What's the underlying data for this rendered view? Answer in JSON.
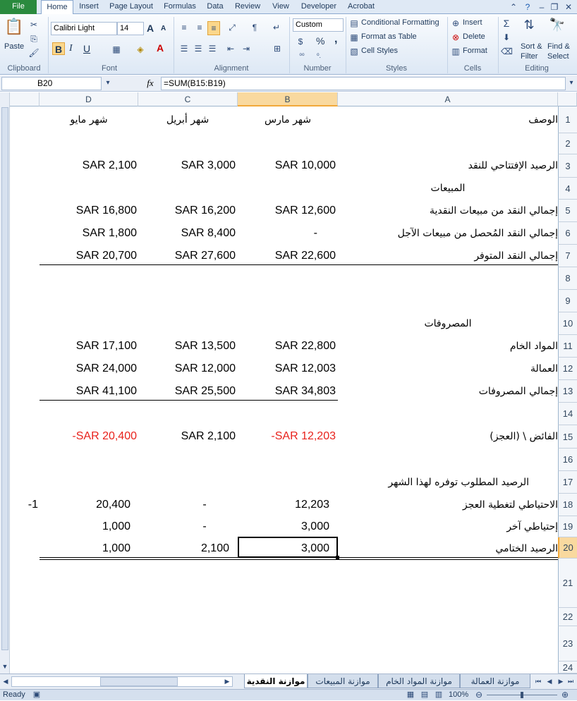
{
  "ribbon_tabs": [
    "File",
    "Home",
    "Insert",
    "Page Layout",
    "Formulas",
    "Data",
    "Review",
    "View",
    "Developer",
    "Acrobat"
  ],
  "clipboard": {
    "paste": "Paste",
    "label": "Clipboard"
  },
  "font": {
    "name": "Calibri Light",
    "size": "14",
    "bold": "B",
    "italic": "I",
    "underline": "U",
    "grow": "A",
    "shrink": "A",
    "color_a": "A",
    "label": "Font"
  },
  "alignment": {
    "label": "Alignment"
  },
  "number": {
    "format": "Custom",
    "percent": "%",
    "comma": ",",
    "label": "Number"
  },
  "styles": {
    "conditional": "Conditional Formatting",
    "table": "Format as Table",
    "cell_styles": "Cell Styles",
    "label": "Styles"
  },
  "cells": {
    "insert": "Insert",
    "delete": "Delete",
    "format": "Format",
    "label": "Cells"
  },
  "editing": {
    "sort": "Sort &",
    "sort2": "Filter",
    "find": "Find &",
    "find2": "Select",
    "label": "Editing"
  },
  "formula_bar": {
    "name_box": "B20",
    "fx": "fx",
    "formula": "=SUM(B15:B19)"
  },
  "columns": [
    "D",
    "C",
    "B",
    "A"
  ],
  "rows": [
    {
      "n": "1",
      "a": "الوصف",
      "b": "شهر مارس",
      "c": "شهر أبريل",
      "d": "شهر مايو"
    },
    {
      "n": "2",
      "a": "",
      "b": "",
      "c": "",
      "d": ""
    },
    {
      "n": "3",
      "a": "الرصيد الإفتتاحي للنقد",
      "b": "SAR 10,000",
      "c": "SAR 3,000",
      "d": "SAR 2,100"
    },
    {
      "n": "4",
      "a": "المبيعات",
      "b": "",
      "c": "",
      "d": ""
    },
    {
      "n": "5",
      "a": "إجمالي النقد من مبيعات النقدية",
      "b": "SAR 12,600",
      "c": "SAR 16,200",
      "d": "SAR 16,800"
    },
    {
      "n": "6",
      "a": "إجمالي النقد المُحصل من مبيعات الآجل",
      "b": "-",
      "c": "SAR 8,400",
      "d": "SAR 1,800"
    },
    {
      "n": "7",
      "a": "إجمالي النقد المتوفر",
      "b": "SAR 22,600",
      "c": "SAR 27,600",
      "d": "SAR 20,700"
    },
    {
      "n": "8",
      "a": "",
      "b": "",
      "c": "",
      "d": ""
    },
    {
      "n": "9",
      "a": "",
      "b": "",
      "c": "",
      "d": ""
    },
    {
      "n": "10",
      "a": "المصروفات",
      "b": "",
      "c": "",
      "d": ""
    },
    {
      "n": "11",
      "a": "المواد الخام",
      "b": "SAR 22,800",
      "c": "SAR 13,500",
      "d": "SAR 17,100"
    },
    {
      "n": "12",
      "a": "العمالة",
      "b": "SAR 12,003",
      "c": "SAR 12,000",
      "d": "SAR 24,000"
    },
    {
      "n": "13",
      "a": "إجمالي المصروفات",
      "b": "SAR 34,803",
      "c": "SAR 25,500",
      "d": "SAR 41,100"
    },
    {
      "n": "14",
      "a": "",
      "b": "",
      "c": "",
      "d": ""
    },
    {
      "n": "15",
      "a": "الفائض \\ (العجز)",
      "b": "-SAR 12,203",
      "c": "SAR 2,100",
      "d": "-SAR 20,400"
    },
    {
      "n": "16",
      "a": "",
      "b": "",
      "c": "",
      "d": ""
    },
    {
      "n": "17",
      "a": "الرصيد المطلوب توفره لهذا الشهر",
      "b": "",
      "c": "",
      "d": ""
    },
    {
      "n": "18",
      "a": "الاحتياطي لتغطية العجز",
      "b": "12,203",
      "c": "-",
      "d": "20,400",
      "e": "-1"
    },
    {
      "n": "19",
      "a": "إحتياطي آخر",
      "b": "3,000",
      "c": "-",
      "d": "1,000"
    },
    {
      "n": "20",
      "a": "الرصيد الختامي",
      "b": "3,000",
      "c": "2,100",
      "d": "1,000"
    },
    {
      "n": "21"
    },
    {
      "n": "22"
    },
    {
      "n": "23"
    },
    {
      "n": "24"
    }
  ],
  "sheet_tabs": [
    "موازنة العمالة",
    "موازنة المواد الخام",
    "موازنة المبيعات",
    "موازنة النقدية"
  ],
  "status": {
    "ready": "Ready",
    "zoom": "100%"
  },
  "colors": {
    "accent": "#2a8a3e",
    "negative": "#e8221c",
    "selection": "#f9d99f"
  }
}
